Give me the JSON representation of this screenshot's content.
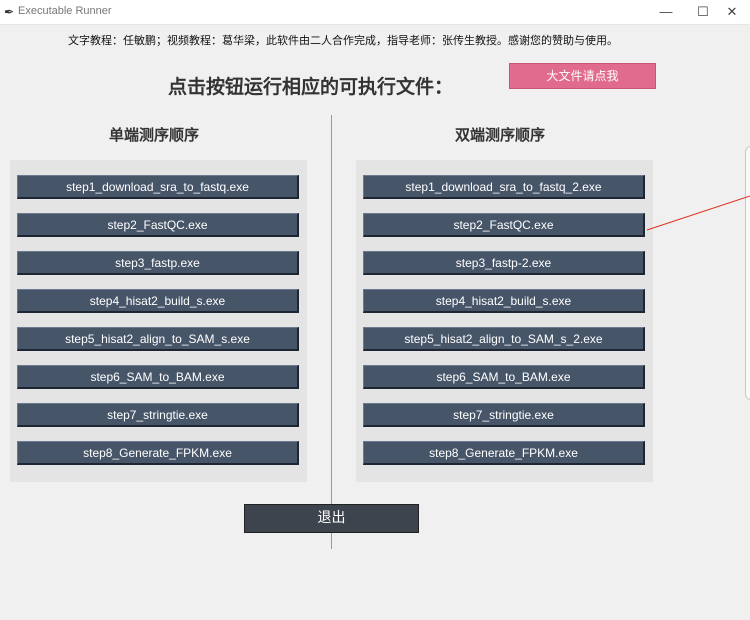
{
  "window": {
    "title": "Executable Runner",
    "minimize_glyph": "—",
    "maximize_glyph": "☐",
    "close_glyph": "✕"
  },
  "credits": "文字教程：任敏鹏；视频教程：葛华梁，此软件由二人合作完成，指导老师：张传生教授。感谢您的赞助与使用。",
  "heading": "点击按钮运行相应的可执行文件：",
  "big_file_button": "大文件请点我",
  "single_end": {
    "title": "单端测序顺序",
    "steps": [
      "step1_download_sra_to_fastq.exe",
      "step2_FastQC.exe",
      "step3_fastp.exe",
      "step4_hisat2_build_s.exe",
      "step5_hisat2_align_to_SAM_s.exe",
      "step6_SAM_to_BAM.exe",
      "step7_stringtie.exe",
      "step8_Generate_FPKM.exe"
    ]
  },
  "paired_end": {
    "title": "双端测序顺序",
    "steps": [
      "step1_download_sra_to_fastq_2.exe",
      "step2_FastQC.exe",
      "step3_fastp-2.exe",
      "step4_hisat2_build_s.exe",
      "step5_hisat2_align_to_SAM_s_2.exe",
      "step6_SAM_to_BAM.exe",
      "step7_stringtie.exe",
      "step8_Generate_FPKM.exe"
    ]
  },
  "exit_button": "退出",
  "colors": {
    "step_button_bg": "#475569",
    "exit_button_bg": "#3e444e",
    "big_file_button_bg": "#e16b8c",
    "annotation_arrow": "#e03020"
  }
}
